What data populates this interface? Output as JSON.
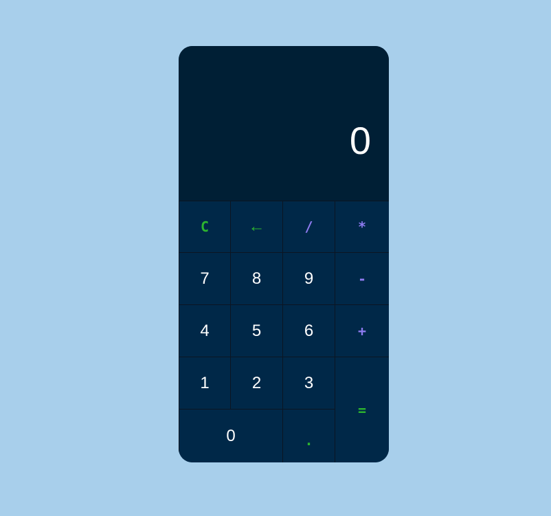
{
  "display": {
    "value": "0"
  },
  "keys": {
    "clear": "C",
    "backspace": "←",
    "divide": "/",
    "multiply": "*",
    "seven": "7",
    "eight": "8",
    "nine": "9",
    "minus": "-",
    "four": "4",
    "five": "5",
    "six": "6",
    "plus": "+",
    "one": "1",
    "two": "2",
    "three": "3",
    "equals": "=",
    "zero": "0",
    "dot": "."
  },
  "colors": {
    "background": "#a8cfeb",
    "display": "#001f35",
    "key": "#002848",
    "accent_green": "#2db52f",
    "accent_purple": "#8e7bf0"
  }
}
